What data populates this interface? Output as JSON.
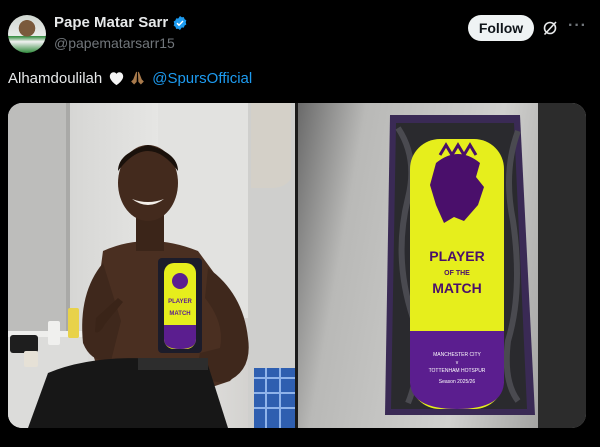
{
  "author": {
    "name": "Pape Matar Sarr",
    "handle": "@papematarsarr15",
    "verified": true
  },
  "actions": {
    "follow_label": "Follow",
    "grok_icon": "grok-icon",
    "more_icon": "more-icon"
  },
  "tweet": {
    "text": "Alhamdoulilah",
    "emojis": [
      "white-heart",
      "folded-hands"
    ],
    "mention": "@SpursOfficial"
  },
  "media": {
    "trophy": {
      "line1": "PLAYER",
      "line2": "OF THE",
      "line3": "MATCH",
      "fixture_line1": "MANCHESTER CITY",
      "fixture_line2": "v",
      "fixture_line3": "TOTTENHAM HOTSPUR",
      "season": "Season 2025/26"
    },
    "mini_trophy": {
      "line1": "PLAYER",
      "line2": "MATCH"
    }
  },
  "colors": {
    "background": "#000000",
    "text": "#e7e9ea",
    "muted": "#71767b",
    "link": "#1d9bf0",
    "verified": "#1d9bf0",
    "trophy_yellow": "#e6ee1c",
    "trophy_purple": "#5b1e8f"
  }
}
